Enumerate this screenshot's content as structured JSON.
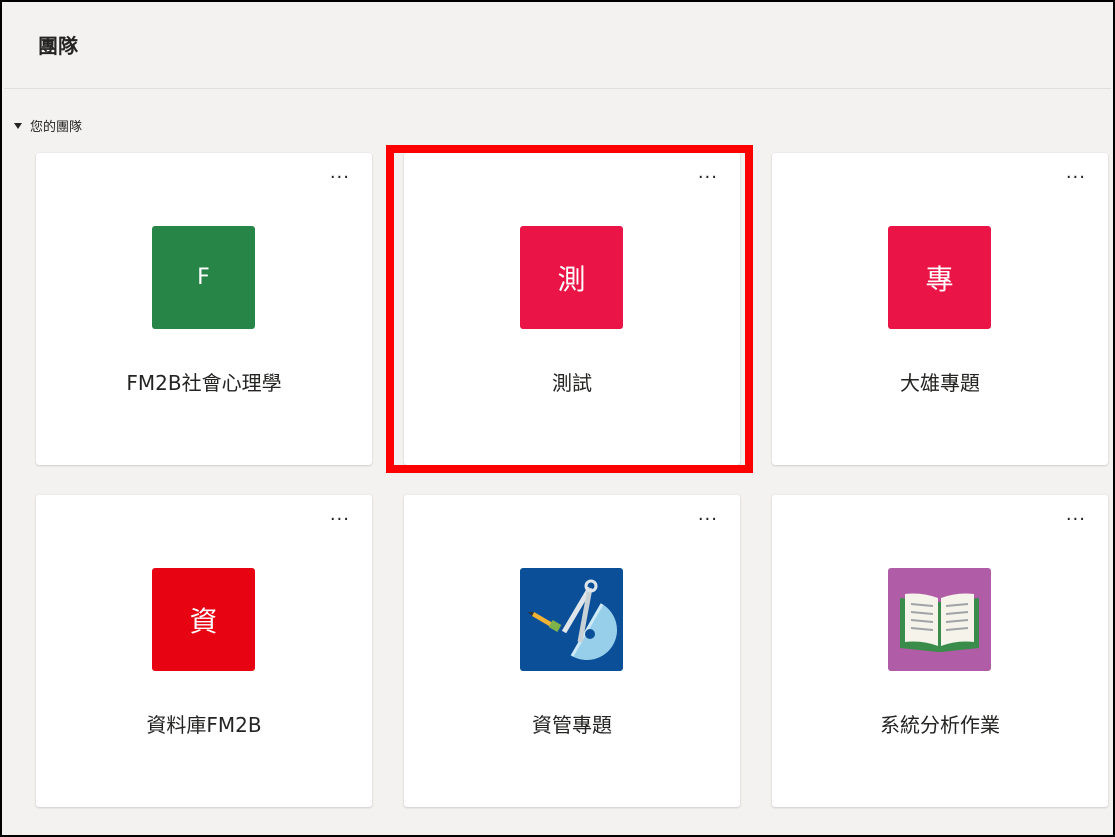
{
  "page": {
    "title": "團隊"
  },
  "section": {
    "label": "您的團隊"
  },
  "teams": [
    {
      "name": "FM2B社會心理學",
      "tile_text": "F",
      "tile_color": "#288548",
      "icon": "letter-avatar"
    },
    {
      "name": "測試",
      "tile_text": "測",
      "tile_color": "#ea1446",
      "icon": "letter-avatar"
    },
    {
      "name": "大雄專題",
      "tile_text": "專",
      "tile_color": "#ea1446",
      "icon": "letter-avatar"
    },
    {
      "name": "資料庫FM2B",
      "tile_text": "資",
      "tile_color": "#e70312",
      "icon": "letter-avatar"
    },
    {
      "name": "資管專題",
      "tile_text": "",
      "tile_color": "#0b4f99",
      "icon": "compass-protractor-icon"
    },
    {
      "name": "系統分析作業",
      "tile_text": "",
      "tile_color": "#b05ca6",
      "icon": "open-book-icon"
    }
  ],
  "more_label": "···",
  "highlight": {
    "color": "#ff0000",
    "target_team": "測試"
  }
}
